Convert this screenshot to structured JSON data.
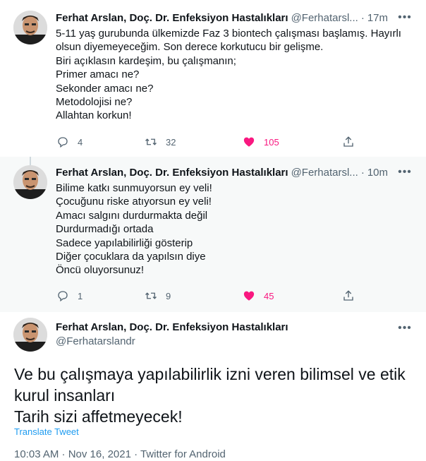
{
  "tweets": [
    {
      "name": "Ferhat Arslan, Doç. Dr. Enfeksiyon Hastalıkları",
      "handle": "@Ferhatarsl...",
      "dot": "·",
      "time": "17m",
      "lines": [
        "5-11 yaş gurubunda ülkemizde Faz 3 biontech çalışması başlamış. Hayırlı",
        "olsun diyemeyeceğim. Son derece korkutucu bir gelişme.",
        "Biri açıklasın kardeşim, bu çalışmanın;",
        "Primer amacı ne?",
        "Sekonder amacı ne?",
        "Metodolojisi ne?",
        "Allahtan korkun!"
      ],
      "replies": "4",
      "retweets": "32",
      "likes": "105"
    },
    {
      "name": "Ferhat Arslan, Doç. Dr. Enfeksiyon Hastalıkları",
      "handle": "@Ferhatarsl...",
      "dot": "·",
      "time": "10m",
      "lines": [
        "Bilime katkı sunmuyorsun ey veli!",
        "Çocuğunu riske atıyorsun ey veli!",
        "Amacı salgını durdurmakta değil",
        "Durdurmadığı ortada",
        "Sadece yapılabilirliği gösterip",
        "Diğer çocuklara da yapılsın diye",
        "Öncü oluyorsunuz!"
      ],
      "replies": "1",
      "retweets": "9",
      "likes": "45"
    }
  ],
  "main_tweet": {
    "name": "Ferhat Arslan, Doç. Dr. Enfeksiyon Hastalıkları",
    "handle": "@Ferhatarslandr",
    "lines": [
      "Ve bu çalışmaya yapılabilirlik izni veren bilimsel ve etik",
      "kurul insanları",
      "Tarih sizi affetmeyecek!"
    ],
    "translate_label": "Translate Tweet",
    "meta": "10:03 AM · Nov 16, 2021 · Twitter for Android"
  },
  "more_label": "•••",
  "icons": [
    "more-icon",
    "reply-icon",
    "retweet-icon",
    "like-icon",
    "share-icon"
  ],
  "colors": {
    "like": "#f91880",
    "link": "#1d9bf0",
    "secondary": "#536471",
    "thread_line": "#cfd9de"
  }
}
